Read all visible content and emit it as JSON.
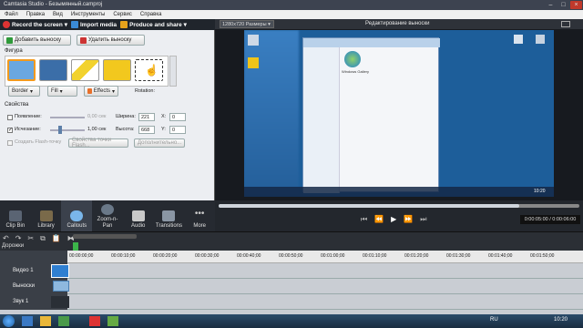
{
  "window": {
    "title": "Camtasia Studio - Безымянный.camproj"
  },
  "menu": [
    "Файл",
    "Правка",
    "Вид",
    "Инструменты",
    "Сервис",
    "Справка"
  ],
  "toolbar": {
    "record": "Record the screen",
    "import": "Import media",
    "produce": "Produce and share"
  },
  "panel": {
    "add_btn": "Добавить выноску",
    "delete_btn": "Удалить выноску",
    "shape_section": "Фигура",
    "border": "Border",
    "fill": "Fill",
    "effects": "Effects",
    "rotation": "Rotation:",
    "props_section": "Свойства",
    "fade_in": "Появление:",
    "fade_in_value": "0,00 сек",
    "fade_out": "Исчезание:",
    "fade_out_value": "1,00 сек",
    "width_label": "Ширина:",
    "width_value": "221",
    "x_label": "X:",
    "x_value": "0",
    "height_label": "Высота:",
    "height_value": "668",
    "y_label": "Y:",
    "y_value": "0",
    "flash_hotspot": "Создать Flash-точку",
    "flash_props": "Свойства точки Flash...",
    "advanced": "Дополнительно..."
  },
  "tabs": [
    {
      "label": "Clip Bin"
    },
    {
      "label": "Library"
    },
    {
      "label": "Callouts"
    },
    {
      "label": "Zoom-n-\nPan"
    },
    {
      "label": "Audio"
    },
    {
      "label": "Transitions"
    },
    {
      "label": "More"
    }
  ],
  "preview": {
    "size_select": "1280x720 Размеры",
    "title": "Редактирование выноски",
    "time": "0:00:05:00 / 0:00:06:00"
  },
  "desktop": {
    "explorer_item": "Windows Gallery",
    "time": "10:20",
    "lang": "RU"
  },
  "timeline": {
    "tracks_label": "Дорожки",
    "tracks": [
      "Видео 1",
      "Выноски",
      "Звук 1"
    ],
    "ticks": [
      "00:00:00;00",
      "00:00:10;00",
      "00:00:20;00",
      "00:00:30;00",
      "00:00:40;00",
      "00:00:50;00",
      "00:01:00;00",
      "00:01:10;00",
      "00:01:20;00",
      "00:01:30;00",
      "00:01:40;00",
      "00:01:50;00"
    ]
  },
  "colors": {
    "accent": "#3c8fd8",
    "dark": "#20252c",
    "panel": "#eceef2"
  }
}
